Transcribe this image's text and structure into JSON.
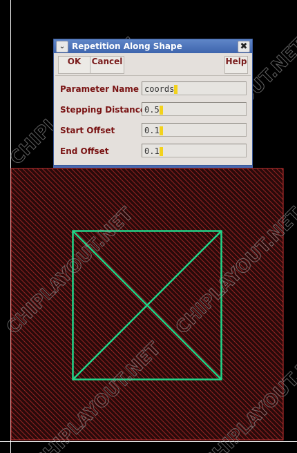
{
  "watermark": "CHIPLAYOUT.NET",
  "colors": {
    "background": "#000000",
    "layer_fill": "#3a1010",
    "layer_hatch": "#c03030",
    "shape_stroke": "#22d68a",
    "dialog_title": "#4a70b8"
  },
  "dialog": {
    "title": "Repetition Along Shape",
    "menu_icon": "chevron-down-icon",
    "close_icon": "close-icon",
    "close_symbol": "✖",
    "menu_symbol": "❯",
    "buttons": {
      "ok": "OK",
      "cancel": "Cancel",
      "help": "Help"
    },
    "fields": [
      {
        "label": "Parameter Name",
        "value": "coords"
      },
      {
        "label": "Stepping Distance",
        "value": "0.5"
      },
      {
        "label": "Start Offset",
        "value": "0.1"
      },
      {
        "label": "End Offset",
        "value": "0.1"
      }
    ]
  }
}
